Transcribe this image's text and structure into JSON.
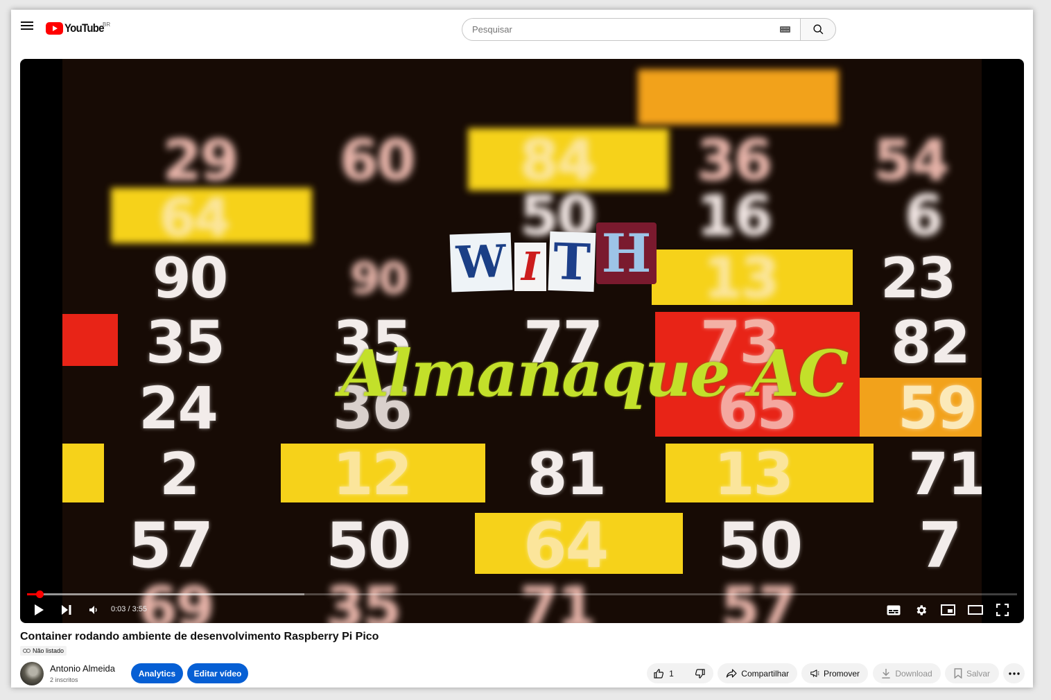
{
  "header": {
    "logo_text": "YouTube",
    "region": "BR",
    "search_placeholder": "Pesquisar"
  },
  "player": {
    "overlay": {
      "with_letters": [
        "W",
        "I",
        "T",
        "H"
      ],
      "script_title": "Almanaque AC"
    },
    "background_numbers": [
      "35",
      "35",
      "77",
      "73",
      "82",
      "24",
      "36",
      "65",
      "59",
      "2",
      "12",
      "81",
      "13",
      "71",
      "57",
      "50",
      "64",
      "50",
      "7",
      "90",
      "90",
      "13",
      "23",
      "64",
      "16",
      "6",
      "50",
      "29",
      "60",
      "84",
      "36",
      "54",
      "69",
      "35",
      "71",
      "57"
    ],
    "time": "0:03 / 3:55",
    "progress_fraction": 0.0128,
    "buffer_fraction": 0.28
  },
  "video": {
    "title": "Container rodando ambiente de desenvolvimento Raspberry Pi Pico",
    "visibility": "Não listado"
  },
  "channel": {
    "name": "Antonio Almeida",
    "subscribers": "2 inscritos"
  },
  "buttons": {
    "analytics": "Analytics",
    "edit": "Editar vídeo",
    "like_count": "1",
    "share": "Compartilhar",
    "promote": "Promover",
    "download": "Download",
    "save": "Salvar"
  },
  "colors": {
    "accent": "#065fd4",
    "brand_red": "#ff0000",
    "script_green": "#c3e02a"
  }
}
